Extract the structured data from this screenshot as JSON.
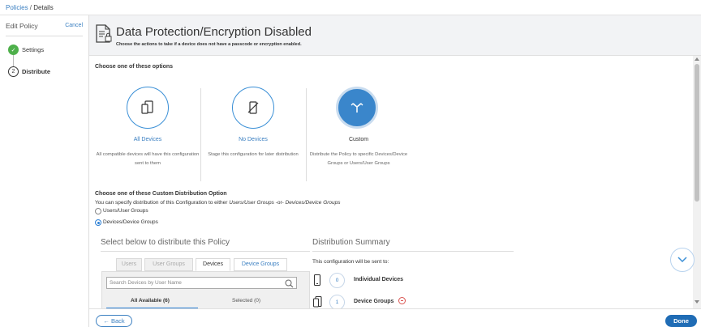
{
  "breadcrumb": {
    "parent": "Policies",
    "separator": " / ",
    "current": "Details"
  },
  "sidebar": {
    "title": "Edit Policy",
    "cancel": "Cancel",
    "steps": [
      {
        "label": "Settings",
        "marker": "✓",
        "state": "done"
      },
      {
        "label": "Distribute",
        "marker": "2",
        "state": "current"
      }
    ]
  },
  "header": {
    "title": "Data Protection/Encryption Disabled",
    "subtitle": "Choose the actions to take if a device does not have a passcode or encryption enabled."
  },
  "options_section": {
    "heading": "Choose one of these options",
    "options": [
      {
        "title": "All Devices",
        "description": "All compatible devices will have this configuration sent to them",
        "icon": "devices-icon",
        "selected": false
      },
      {
        "title": "No Devices",
        "description": "Stage this configuration for later distribution",
        "icon": "no-device-icon",
        "selected": false
      },
      {
        "title": "Custom",
        "description": "Distribute the Policy to specific Devices/Device Groups or Users/User Groups",
        "icon": "split-arrows-icon",
        "selected": true
      }
    ]
  },
  "custom_section": {
    "heading": "Choose one of these Custom Distribution Option",
    "description_prefix": "You can specify distribution of this Configuration to either ",
    "description_users": "Users/User Groups",
    "description_or": " -or- ",
    "description_devices": "Devices/Device Groups",
    "radio_users": "Users/User Groups",
    "radio_devices": "Devices/Device Groups",
    "selected_radio": "devices"
  },
  "select_panel": {
    "title": "Select below to distribute this Policy",
    "tabs": [
      "Users",
      "User Groups",
      "Devices",
      "Device Groups"
    ],
    "search_placeholder": "Search Devices by User Name",
    "available_label": "All Available (6)",
    "selected_label": "Selected (0)"
  },
  "summary": {
    "title": "Distribution Summary",
    "description": "This configuration will be sent to:",
    "rows": [
      {
        "count": "0",
        "label": "Individual Devices"
      },
      {
        "count": "1",
        "label": "Device Groups"
      }
    ]
  },
  "footer": {
    "back": "← Back",
    "done": "Done"
  },
  "colors": {
    "accent": "#3a7fc1",
    "selected_circle": "#3a86cb",
    "done_green": "#4eb04b",
    "primary_button": "#1f6cb5",
    "remove_red": "#d9534f"
  }
}
